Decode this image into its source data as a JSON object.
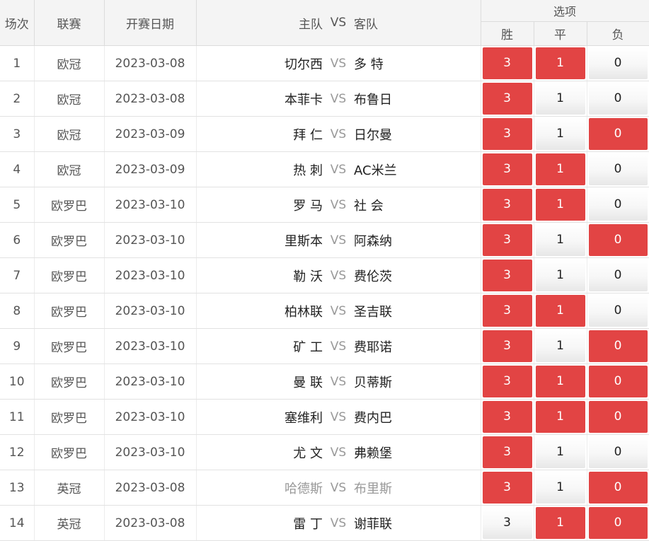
{
  "header": {
    "col_no": "场次",
    "col_league": "联赛",
    "col_date": "开赛日期",
    "col_home": "主队",
    "col_vs": "VS",
    "col_away": "客队",
    "col_options": "选项",
    "opt_win": "胜",
    "opt_draw": "平",
    "opt_lose": "负"
  },
  "rows": [
    {
      "no": "1",
      "league": "欧冠",
      "date": "2023-03-08",
      "home": "切尔西",
      "vs": "VS",
      "away": "多 特",
      "win": "3",
      "draw": "1",
      "lose": "0",
      "sel": [
        true,
        true,
        false
      ],
      "muted": false
    },
    {
      "no": "2",
      "league": "欧冠",
      "date": "2023-03-08",
      "home": "本菲卡",
      "vs": "VS",
      "away": "布鲁日",
      "win": "3",
      "draw": "1",
      "lose": "0",
      "sel": [
        true,
        false,
        false
      ],
      "muted": false
    },
    {
      "no": "3",
      "league": "欧冠",
      "date": "2023-03-09",
      "home": "拜 仁",
      "vs": "VS",
      "away": "日尔曼",
      "win": "3",
      "draw": "1",
      "lose": "0",
      "sel": [
        true,
        false,
        true
      ],
      "muted": false
    },
    {
      "no": "4",
      "league": "欧冠",
      "date": "2023-03-09",
      "home": "热 刺",
      "vs": "VS",
      "away": "AC米兰",
      "win": "3",
      "draw": "1",
      "lose": "0",
      "sel": [
        true,
        true,
        false
      ],
      "muted": false
    },
    {
      "no": "5",
      "league": "欧罗巴",
      "date": "2023-03-10",
      "home": "罗 马",
      "vs": "VS",
      "away": "社 会",
      "win": "3",
      "draw": "1",
      "lose": "0",
      "sel": [
        true,
        true,
        false
      ],
      "muted": false
    },
    {
      "no": "6",
      "league": "欧罗巴",
      "date": "2023-03-10",
      "home": "里斯本",
      "vs": "VS",
      "away": "阿森纳",
      "win": "3",
      "draw": "1",
      "lose": "0",
      "sel": [
        true,
        false,
        true
      ],
      "muted": false
    },
    {
      "no": "7",
      "league": "欧罗巴",
      "date": "2023-03-10",
      "home": "勒 沃",
      "vs": "VS",
      "away": "费伦茨",
      "win": "3",
      "draw": "1",
      "lose": "0",
      "sel": [
        true,
        false,
        false
      ],
      "muted": false
    },
    {
      "no": "8",
      "league": "欧罗巴",
      "date": "2023-03-10",
      "home": "柏林联",
      "vs": "VS",
      "away": "圣吉联",
      "win": "3",
      "draw": "1",
      "lose": "0",
      "sel": [
        true,
        true,
        false
      ],
      "muted": false
    },
    {
      "no": "9",
      "league": "欧罗巴",
      "date": "2023-03-10",
      "home": "矿 工",
      "vs": "VS",
      "away": "费耶诺",
      "win": "3",
      "draw": "1",
      "lose": "0",
      "sel": [
        true,
        false,
        true
      ],
      "muted": false
    },
    {
      "no": "10",
      "league": "欧罗巴",
      "date": "2023-03-10",
      "home": "曼 联",
      "vs": "VS",
      "away": "贝蒂斯",
      "win": "3",
      "draw": "1",
      "lose": "0",
      "sel": [
        true,
        true,
        true
      ],
      "muted": false
    },
    {
      "no": "11",
      "league": "欧罗巴",
      "date": "2023-03-10",
      "home": "塞维利",
      "vs": "VS",
      "away": "费内巴",
      "win": "3",
      "draw": "1",
      "lose": "0",
      "sel": [
        true,
        true,
        true
      ],
      "muted": false
    },
    {
      "no": "12",
      "league": "欧罗巴",
      "date": "2023-03-10",
      "home": "尤 文",
      "vs": "VS",
      "away": "弗赖堡",
      "win": "3",
      "draw": "1",
      "lose": "0",
      "sel": [
        true,
        false,
        false
      ],
      "muted": false
    },
    {
      "no": "13",
      "league": "英冠",
      "date": "2023-03-08",
      "home": "哈德斯",
      "vs": "VS",
      "away": "布里斯",
      "win": "3",
      "draw": "1",
      "lose": "0",
      "sel": [
        true,
        false,
        true
      ],
      "muted": true
    },
    {
      "no": "14",
      "league": "英冠",
      "date": "2023-03-08",
      "home": "雷 丁",
      "vs": "VS",
      "away": "谢菲联",
      "win": "3",
      "draw": "1",
      "lose": "0",
      "sel": [
        false,
        true,
        true
      ],
      "muted": false
    }
  ],
  "colors": {
    "selected": "#e24444",
    "header_bg": "#f4f4f4"
  }
}
